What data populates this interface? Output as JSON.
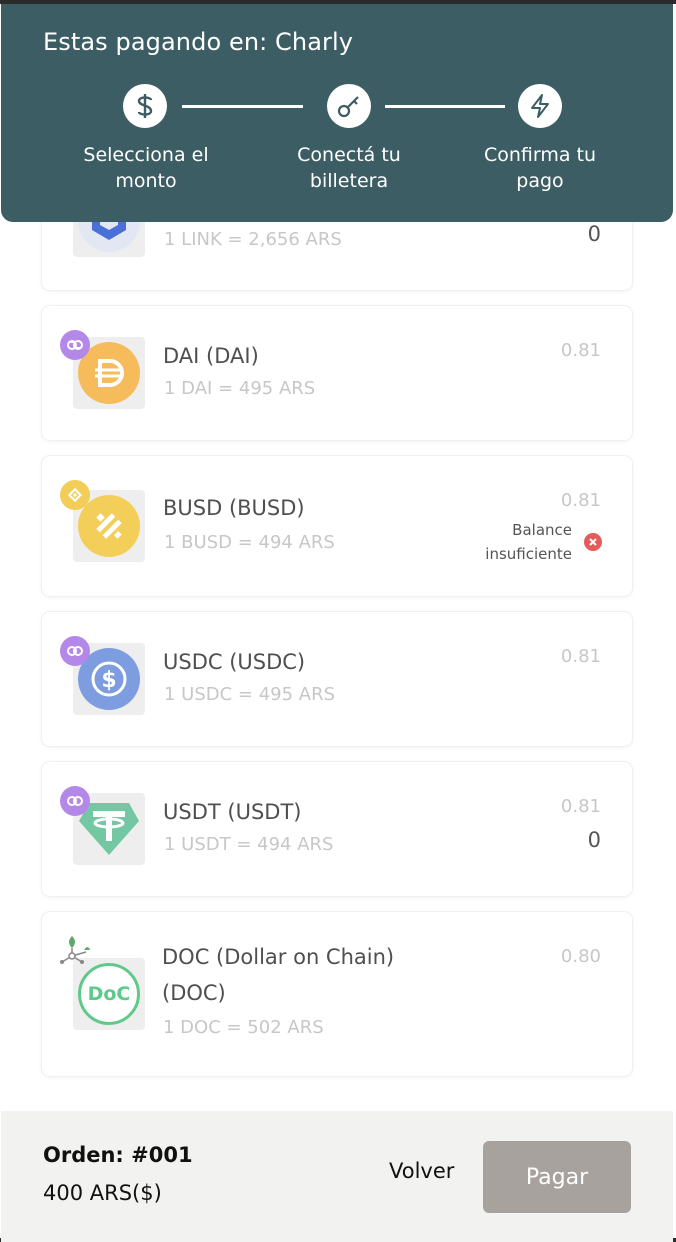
{
  "header": {
    "title": "Estas pagando en: Charly",
    "steps": [
      {
        "label": "Selecciona el monto",
        "icon": "dollar-icon"
      },
      {
        "label": "Conectá tu billetera",
        "icon": "key-icon"
      },
      {
        "label": "Confirma tu pago",
        "icon": "lightning-icon"
      }
    ]
  },
  "tokens": [
    {
      "name": "",
      "rate": "1 LINK = 2,656 ARS",
      "amount": "",
      "balance": "0",
      "icon": "chainlink-icon",
      "network_icon": "",
      "color": "#4a6fd6"
    },
    {
      "name": "DAI (DAI)",
      "rate": "1 DAI = 495 ARS",
      "amount": "0.81",
      "balance": "",
      "icon": "dai-icon",
      "network_icon": "polygon-icon",
      "color": "#f6bb5a"
    },
    {
      "name": "BUSD (BUSD)",
      "rate": "1 BUSD = 494 ARS",
      "amount": "0.81",
      "balance": "",
      "warning": "Balance insuficiente",
      "icon": "busd-icon",
      "network_icon": "bnb-icon",
      "color": "#f3cf59"
    },
    {
      "name": "USDC (USDC)",
      "rate": "1 USDC = 495 ARS",
      "amount": "0.81",
      "balance": "",
      "icon": "usdc-icon",
      "network_icon": "polygon-icon",
      "color": "#7d9de0"
    },
    {
      "name": "USDT (USDT)",
      "rate": "1 USDT = 494 ARS",
      "amount": "0.81",
      "balance": "0",
      "icon": "usdt-icon",
      "network_icon": "polygon-icon",
      "color": "#73c8a3"
    },
    {
      "name": "DOC (Dollar on Chain)",
      "name_line2": "(DOC)",
      "rate": "1 DOC = 502 ARS",
      "amount": "0.80",
      "balance": "",
      "icon": "doc-icon",
      "network_icon": "rsk-icon",
      "color": "#5fc98a"
    }
  ],
  "footer": {
    "order_label": "Orden: #001",
    "order_amount": "400 ARS($)",
    "back_label": "Volver",
    "pay_label": "Pagar"
  },
  "colors": {
    "header_bg": "#3c5d63",
    "polygon": "#b488e8",
    "bnb": "#f2cd58",
    "pay_button": "#a8a29e",
    "error": "#e45b5b"
  }
}
